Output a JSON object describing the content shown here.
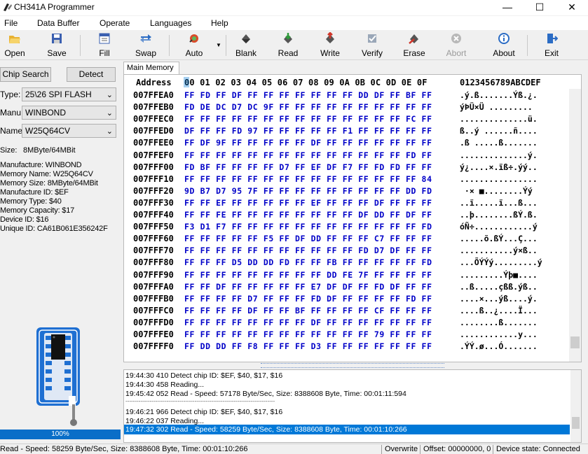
{
  "window": {
    "title": "CH341A Programmer",
    "minimize_glyph": "—",
    "maximize_glyph": "☐",
    "close_glyph": "✕"
  },
  "menu": [
    "File",
    "Data Buffer",
    "Operate",
    "Languages",
    "Help"
  ],
  "toolbar": [
    {
      "label": "Open",
      "icon": "folder-open-icon",
      "enabled": true
    },
    {
      "label": "Save",
      "icon": "floppy-disk-icon",
      "enabled": true
    },
    {
      "label": "Fill",
      "icon": "fill-icon",
      "enabled": true
    },
    {
      "label": "Swap",
      "icon": "swap-arrows-icon",
      "enabled": true
    },
    {
      "label": "Auto",
      "icon": "auto-gear-icon",
      "enabled": true
    },
    {
      "label": "Blank",
      "icon": "blank-check-icon",
      "enabled": true
    },
    {
      "label": "Read",
      "icon": "read-chip-icon",
      "enabled": true
    },
    {
      "label": "Write",
      "icon": "write-chip-icon",
      "enabled": true
    },
    {
      "label": "Verify",
      "icon": "verify-icon",
      "enabled": true
    },
    {
      "label": "Erase",
      "icon": "erase-icon",
      "enabled": true
    },
    {
      "label": "Abort",
      "icon": "abort-icon",
      "enabled": false
    },
    {
      "label": "About",
      "icon": "info-icon",
      "enabled": true
    },
    {
      "label": "Exit",
      "icon": "exit-door-icon",
      "enabled": true
    }
  ],
  "left": {
    "chip_search": "Chip Search",
    "detect": "Detect",
    "type_label": "Type:",
    "type_value": "25\\26 SPI FLASH",
    "manu_label": "Manu:",
    "manu_value": "WINBOND",
    "name_label": "Name:",
    "name_value": "W25Q64CV",
    "size_label": "Size:",
    "size_value": "8MByte/64MBit",
    "info": [
      "Manufacture: WINBOND",
      "Memory Name: W25Q64CV",
      "Memory Size: 8MByte/64MBit",
      "Manufacture ID: $EF",
      "Memory Type: $40",
      "Memory Capacity: $17",
      "Device ID: $16",
      "Unique ID: CA61B061E356242F"
    ],
    "progress_text": "100%",
    "progress_value": 1.0
  },
  "tab": "Main Memory",
  "hex": {
    "header_address": "Address",
    "header_cols": "00 01 02 03 04 05 06 07 08 09 0A 0B 0C 0D 0E 0F",
    "header_ascii": "0123456789ABCDEF",
    "rows": [
      {
        "addr": "007FFEA0",
        "hex": "FF FD FF DF FF FF FF FF FF FF FF DD DF FF BF FF",
        "ascii": ".ý.ß.......Ýß.¿."
      },
      {
        "addr": "007FFEB0",
        "hex": "FD DE DC D7 DC 9F FF FF FF FF FF FF FF FF FF FF",
        "ascii": "ýÞÜ×Ü ......... "
      },
      {
        "addr": "007FFEC0",
        "hex": "FF FF FF FF FF FF FF FF FF FF FF FF FF FF FC FF",
        "ascii": "..............ü."
      },
      {
        "addr": "007FFED0",
        "hex": "DF FF FF FD 97 FF FF FF FF FF F1 FF FF FF FF FF",
        "ascii": "ß..ý ......ñ...."
      },
      {
        "addr": "007FFEE0",
        "hex": "FF DF 9F FF FF FF FF FF DF FF FF FF FF FF FF FF",
        "ascii": ".ß .....ß......."
      },
      {
        "addr": "007FFEF0",
        "hex": "FF FF FF FF FF FF FF FF FF FF FF FF FF FF FD FF",
        "ascii": "..............ý."
      },
      {
        "addr": "007FFF00",
        "hex": "FD BF FF FF FF FF D7 FF EF DF F7 FF FD FD FF FF",
        "ascii": "ý¿....×.ïß÷.ýý.."
      },
      {
        "addr": "007FFF10",
        "hex": "FF FF FF FF FF FF FF FF FF FF FF FF FF FF FF 84",
        "ascii": "................"
      },
      {
        "addr": "007FFF20",
        "hex": "9D B7 D7 95 7F FF FF FF FF FF FF FF FF FF DD FD",
        "ascii": " ·× ■........Ýý"
      },
      {
        "addr": "007FFF30",
        "hex": "FF FF EF FF FF FF FF FF EF FF FF FF DF FF FF FF",
        "ascii": "..ï.....ï...ß..."
      },
      {
        "addr": "007FFF40",
        "hex": "FF FF FE FF FF FF FF FF FF FF FF DF DD FF DF FF",
        "ascii": "..þ........ßÝ.ß."
      },
      {
        "addr": "007FFF50",
        "hex": "F3 D1 F7 FF FF FF FF FF FF FF FF FF FF FF FF FD",
        "ascii": "óÑ÷............ý"
      },
      {
        "addr": "007FFF60",
        "hex": "FF FF FF FF FF F5 FF DF DD FF FF FF C7 FF FF FF",
        "ascii": ".....õ.ßÝ...Ç..."
      },
      {
        "addr": "007FFF70",
        "hex": "FF FF FF FF FF FF FF FF FF FF FF FD D7 DF FF FF",
        "ascii": "...........ý×ß.."
      },
      {
        "addr": "007FFF80",
        "hex": "FF FF FF D5 DD DD FD FF FF FB FF FF FF FF FF FD",
        "ascii": "...ÕÝÝý.........ý"
      },
      {
        "addr": "007FFF90",
        "hex": "FF FF FF FF FF FF FF FF FF DD FE 7F FF FF FF FF",
        "ascii": ".........Ýþ■...."
      },
      {
        "addr": "007FFFA0",
        "hex": "FF FF DF FF FF FF FF FF E7 DF DF FF FD DF FF FF",
        "ascii": "..ß.....çßß.ýß.."
      },
      {
        "addr": "007FFFB0",
        "hex": "FF FF FF FF D7 FF FF FF FD DF FF FF FF FF FD FF",
        "ascii": "....×...ýß....ý."
      },
      {
        "addr": "007FFFC0",
        "hex": "FF FF FF FF DF FF FF BF FF FF FF FF CF FF FF FF",
        "ascii": "....ß..¿....Ï..."
      },
      {
        "addr": "007FFFD0",
        "hex": "FF FF FF FF FF FF FF FF DF FF FF FF FF FF FF FF",
        "ascii": "........ß......."
      },
      {
        "addr": "007FFFE0",
        "hex": "FF FF FF FF FF FF FF FF FF FF FF FF 79 FF FF FF",
        "ascii": "............y..."
      },
      {
        "addr": "007FFFF0",
        "hex": "FF DD DD FF F8 FF FF FF D3 FF FF FF FF FF FF FF",
        "ascii": ".ÝÝ.ø...Ó......."
      }
    ]
  },
  "log": [
    "19:44:30 410 Detect chip ID: $EF, $40, $17, $16",
    "19:44:30 458 Reading...",
    "19:45:42 052 Read - Speed: 57178 Byte/Sec, Size: 8388608 Byte, Time: 00:01:11:594",
    "--------------------------------------------------------------------------------",
    "19:46:21 966 Detect chip ID: $EF, $40, $17, $16",
    "19:46:22 037 Reading...",
    "19:47:32 302 Read - Speed: 58259 Byte/Sec, Size: 8388608 Byte, Time: 00:01:10:266"
  ],
  "status": {
    "message": "Read - Speed: 58259 Byte/Sec, Size: 8388608 Byte, Time: 00:01:10:266",
    "mode": "Overwrite",
    "offset": "Offset: 00000000, 0",
    "device": "Device state: Connected"
  },
  "colors": {
    "hex_text": "#0000c8",
    "selection": "#0078d7",
    "progress": "#0a6ec8",
    "chip_board": "#1e6fd2"
  }
}
